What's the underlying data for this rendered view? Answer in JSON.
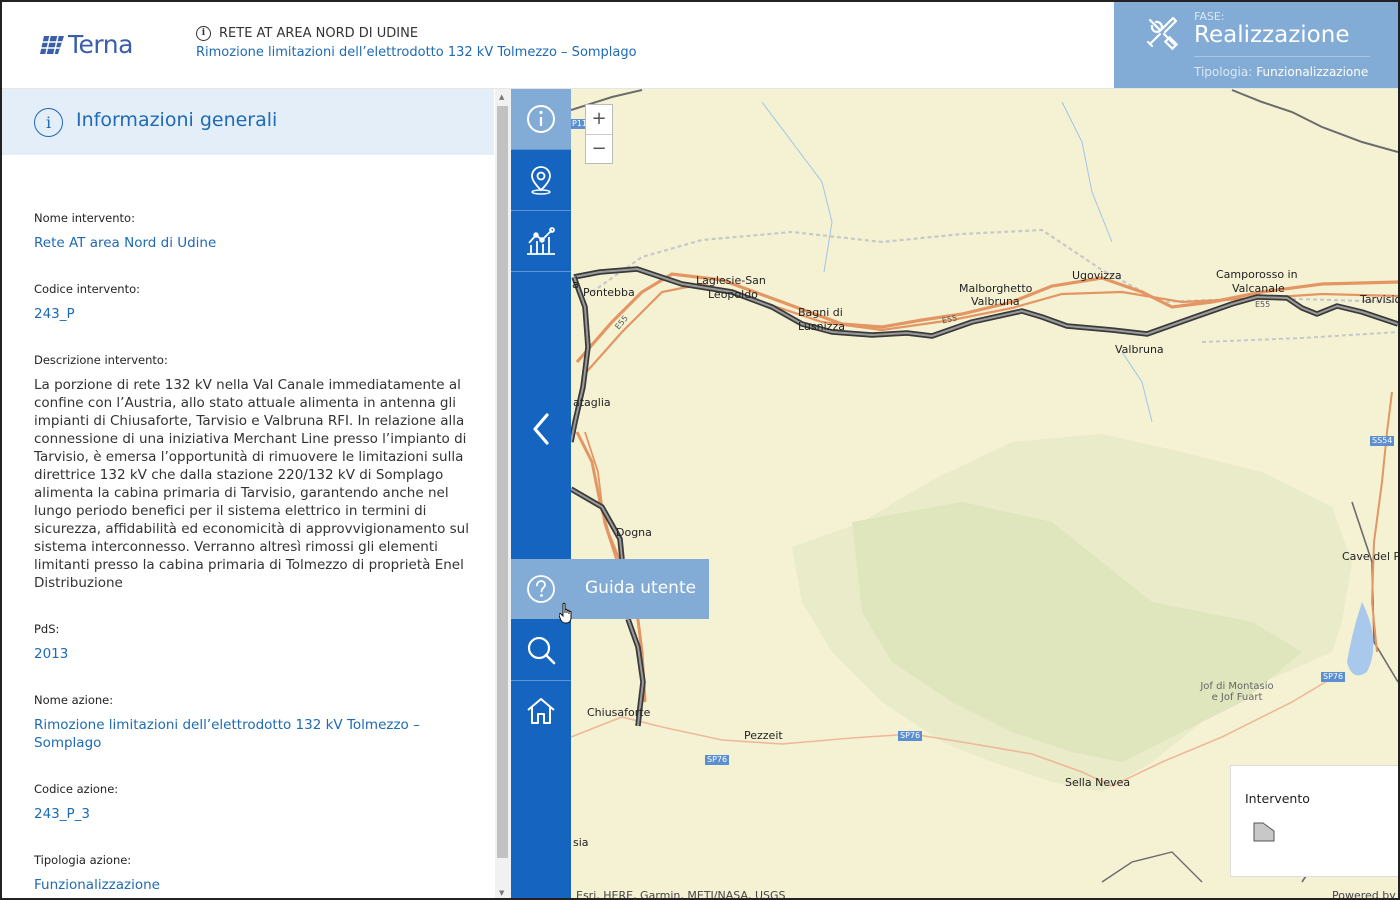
{
  "header": {
    "logo_text": "Terna",
    "area": "RETE AT AREA NORD DI UDINE",
    "title": "Rimozione limitazioni dell’elettrodotto 132 kV Tolmezzo – Somplago"
  },
  "phase": {
    "label": "FASE:",
    "value": "Realizzazione",
    "tipologia_label": "Tipologia:",
    "tipologia_value": "Funzionalizzazione"
  },
  "panel": {
    "title": "Informazioni generali",
    "fields": [
      {
        "label": "Nome intervento:",
        "value": "Rete AT area Nord di Udine"
      },
      {
        "label": "Codice intervento:",
        "value": "243_P"
      },
      {
        "label": "Descrizione intervento:",
        "value": "La porzione di rete 132 kV nella Val Canale immediatamente al confine con l’Austria, allo stato attuale alimenta in antenna gli impianti di Chiusaforte, Tarvisio e Valbruna RFI. In relazione alla connessione di una iniziativa Merchant Line presso l’impianto di Tarvisio, è emersa l’opportunità di rimuovere le limitazioni sulla direttrice 132 kV che dalla stazione 220/132 kV di Somplago alimenta la cabina primaria di Tarvisio, garantendo anche nel lungo periodo benefici per il sistema elettrico in termini di sicurezza, affidabilità ed economicità di approvvigionamento sul sistema interconnesso. Verranno altresì rimossi gli elementi limitanti presso la cabina primaria di Tolmezzo di proprietà Enel Distribuzione"
      },
      {
        "label": "PdS:",
        "value": "2013"
      },
      {
        "label": "Nome azione:",
        "value": "Rimozione limitazioni dell’elettrodotto 132 kV Tolmezzo – Somplago"
      },
      {
        "label": "Codice azione:",
        "value": "243_P_3"
      },
      {
        "label": "Tipologia azione:",
        "value": "Funzionalizzazione"
      }
    ]
  },
  "toolbar": {
    "guida_label": "Guida utente",
    "zoom_in": "+",
    "zoom_out": "−"
  },
  "map": {
    "labels": {
      "pontebba": "Pontebba",
      "laglesie": "Laglesie-San",
      "leopoldo": "Leopoldo",
      "bagni": "Bagni di",
      "lusnizza": "Lusnizza",
      "malborghetto": "Malborghetto",
      "valbruna_a": "Valbruna",
      "ugovizza": "Ugovizza",
      "camporosso": "Camporosso in",
      "valcanale": "Valcanale",
      "tarvisio": "Tarvisio",
      "valbruna_b": "Valbruna",
      "dogna": "Dogna",
      "chiusaforte": "Chiusaforte",
      "pezzeit": "Pezzeit",
      "sella_nevea": "Sella Nevea",
      "cave_del": "Cave del P",
      "a_left": "a",
      "sia": "sia",
      "ataglia": "ataglia",
      "jof_a": "Jof di Montasio",
      "jof_b": "e Jof Fuart"
    },
    "roads": {
      "e55_a": "E55",
      "e55_b": "E55",
      "e55_c": "E55",
      "sp76_a": "SP76",
      "sp76_b": "SP76",
      "sp76_c": "SP76",
      "ss54": "SS54",
      "p11": "P11"
    },
    "attribution": "Esri, HERE, Garmin, METI/NASA, USGS",
    "powered": "Powered by"
  },
  "legend": {
    "title": "Intervento"
  },
  "colors": {
    "brand_blue": "#1565c0",
    "phase_bg": "#82abd6",
    "link": "#1e6ab5",
    "panel_head": "#e3eef8",
    "map_bg": "#f5f2d4"
  }
}
